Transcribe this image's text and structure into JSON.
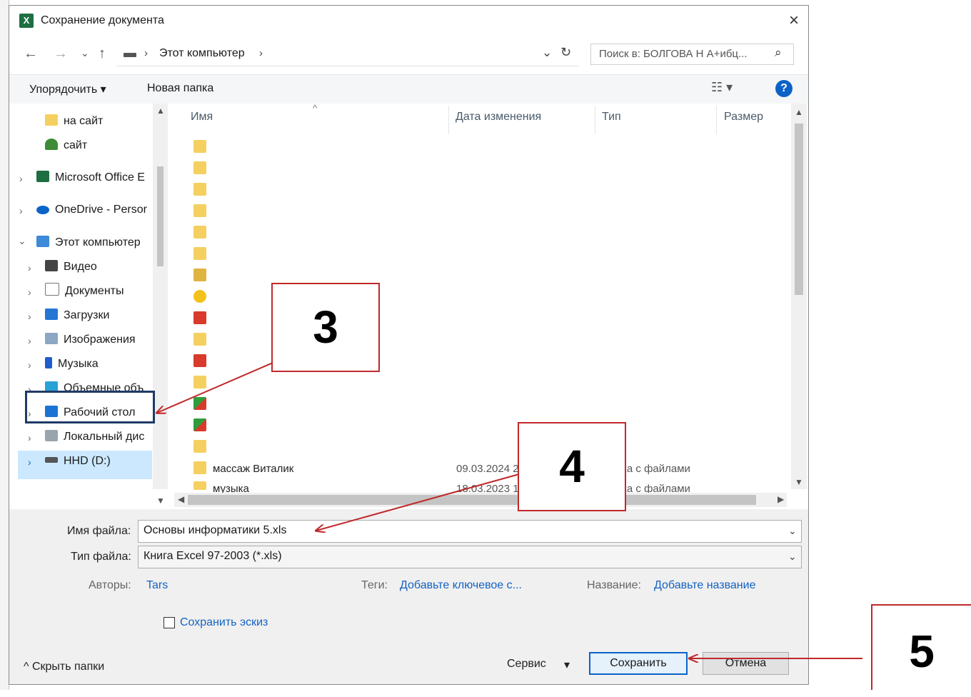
{
  "dialog": {
    "title": "Сохранение документа",
    "app_icon": "excel-icon",
    "close": "×"
  },
  "address": {
    "back": "←",
    "forward": "→",
    "history": "⌄",
    "up": "↑",
    "sep": "›",
    "location": "Этот компьютер",
    "sep2": "›",
    "dropdown": "⌄",
    "refresh": "↻",
    "search_text": "Поиск в: БОЛГОВА Н А+ибц...",
    "search_icon": "⌕"
  },
  "toolbar": {
    "organize": "Упорядочить ▾",
    "new_folder": "Новая папка",
    "view": "☷ ▾",
    "help": "?"
  },
  "nav": {
    "items": [
      {
        "label": "на сайт",
        "icon": "folder-icon"
      },
      {
        "label": "сайт",
        "icon": "tree-icon"
      },
      {
        "label": "Microsoft Office E",
        "icon": "excel-icon"
      },
      {
        "label": "OneDrive - Persor",
        "icon": "cloud-icon"
      },
      {
        "label": "Этот компьютер",
        "icon": "computer-icon"
      },
      {
        "label": "Видео",
        "icon": "video-icon"
      },
      {
        "label": "Документы",
        "icon": "documents-icon"
      },
      {
        "label": "Загрузки",
        "icon": "downloads-icon"
      },
      {
        "label": "Изображения",
        "icon": "images-icon"
      },
      {
        "label": "Музыка",
        "icon": "music-icon"
      },
      {
        "label": "Объемные объ",
        "icon": "3d-objects-icon"
      },
      {
        "label": "Рабочий стол",
        "icon": "desktop-icon"
      },
      {
        "label": "Локальный дис",
        "icon": "local-disk-icon"
      },
      {
        "label": "HHD (D:)",
        "icon": "hdd-icon"
      }
    ]
  },
  "columns": {
    "name": "Имя",
    "modified": "Дата изменения",
    "type": "Тип",
    "size": "Размер"
  },
  "rows": {
    "row15_name": "массаж Виталик",
    "row15_date": "09.03.2024 2",
    "row15_type": "ка с файлами",
    "row16_name": "музыка",
    "row16_date": "18.03.2023 1",
    "row16_type": "ка с файлами"
  },
  "form": {
    "filename_label": "Имя файла:",
    "filename_value": "Основы информатики 5.xls",
    "filetype_label": "Тип файла:",
    "filetype_value": "Книга Excel 97-2003 (*.xls)",
    "authors_label": "Авторы:",
    "authors_value": "Tars",
    "tags_label": "Теги:",
    "tags_value": "Добавьте ключевое с...",
    "title_label": "Название:",
    "title_value": "Добавьте название",
    "thumbnail_label": "Сохранить эскиз",
    "hide_folders": "^ Скрыть папки",
    "tools": "Сервис",
    "tools_arrow": "▾",
    "save": "Сохранить",
    "cancel": "Отмена"
  },
  "annotations": {
    "step3": "3",
    "step4": "4",
    "step5": "5"
  },
  "colors": {
    "annotation_red": "#c0282a",
    "highlight_navy": "#1f3b66",
    "accent_blue": "#0a64c8"
  }
}
